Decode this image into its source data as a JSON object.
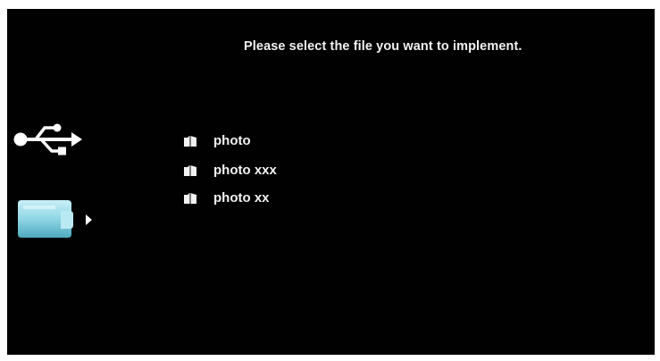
{
  "header": {
    "prompt": "Please select the file you want to implement."
  },
  "sources": [
    {
      "icon": "usb-icon",
      "selected": false
    },
    {
      "icon": "sd-card-icon",
      "selected": true
    }
  ],
  "files": [
    {
      "name": "photo",
      "icon": "folder-icon"
    },
    {
      "name": "photo xxx",
      "icon": "folder-icon"
    },
    {
      "name": "photo xx",
      "icon": "folder-icon"
    }
  ],
  "colors": {
    "background": "#010101",
    "text": "#f2f2f2",
    "card_glow": "#8fd6e6"
  }
}
